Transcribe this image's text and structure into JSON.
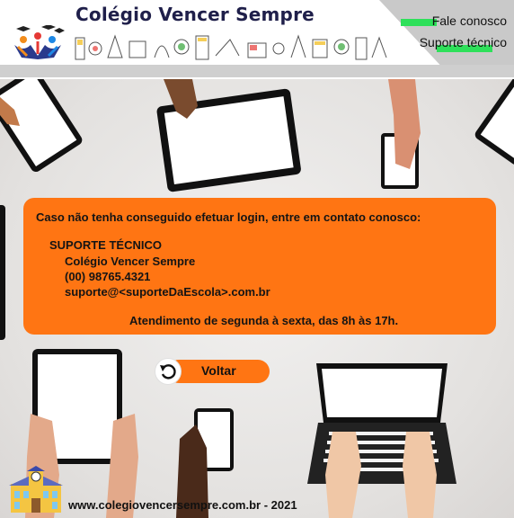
{
  "header": {
    "school_name": "Colégio Vencer Sempre",
    "links": {
      "fale_conosco": "Fale conosco",
      "suporte_tecnico": "Suporte técnico"
    }
  },
  "info_box": {
    "intro": "Caso não tenha conseguido efetuar login, entre em contato conosco:",
    "section_title": "SUPORTE TÉCNICO",
    "school": "Colégio Vencer Sempre",
    "phone": "(00) 98765.4321",
    "email": "suporte@<suporteDaEscola>.com.br",
    "hours": "Atendimento de segunda à sexta, das 8h às 17h."
  },
  "back_button": {
    "label": "Voltar"
  },
  "footer": {
    "text": "www.colegiovencersempre.com.br - 2021"
  },
  "colors": {
    "accent_orange": "#ff7513",
    "highlight_green": "#2ee05a",
    "title_navy": "#1f1f4a"
  }
}
